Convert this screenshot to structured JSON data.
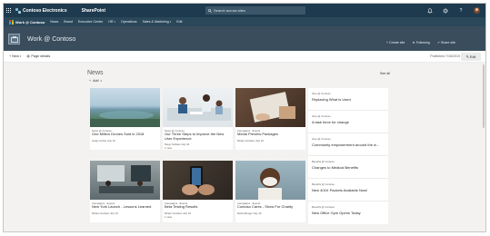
{
  "suite": {
    "brand": "Contoso Electronics",
    "app": "SharePoint",
    "search_placeholder": "Search across sites",
    "icons": [
      "app-launcher-icon",
      "notifications-icon",
      "settings-icon",
      "help-icon",
      "user-avatar"
    ]
  },
  "hub": {
    "title": "Work @ Contoso",
    "items": [
      {
        "label": "News",
        "caret": false
      },
      {
        "label": "Brand",
        "caret": false
      },
      {
        "label": "Executive Center",
        "caret": false
      },
      {
        "label": "HR",
        "caret": true
      },
      {
        "label": "Operations",
        "caret": false
      },
      {
        "label": "Sales & Marketing",
        "caret": true
      },
      {
        "label": "Edit",
        "caret": false
      }
    ]
  },
  "site": {
    "title": "Work @ Contoso",
    "actions": {
      "create": "+ Create site",
      "following": "Following",
      "share": "Share site"
    }
  },
  "commandbar": {
    "new": "New",
    "page_details": "Page details",
    "published": "Published 7/16/2019",
    "edit": "Edit"
  },
  "news": {
    "title": "News",
    "add": "Add",
    "see_all": "See all",
    "cards": [
      {
        "category": "News @ Contoso",
        "title": "One Million Drones Sold in 2018",
        "author": "Grady Archie",
        "date": "July 16",
        "views": ""
      },
      {
        "category": "News @ Contoso",
        "title": "Our Three Steps to Improve the New User Experience",
        "author": "Diego Siciliani",
        "date": "July 16",
        "views": "1 view"
      },
      {
        "category": "Campaigns · Events",
        "title": "Media Preview Packages",
        "author": "Miriam Graham",
        "date": "July 16",
        "views": ""
      },
      {
        "category": "Campaigns · Events",
        "title": "New York Launch - Lessons Learned",
        "author": "Miriam Graham",
        "date": "July 16",
        "views": ""
      },
      {
        "category": "Campaigns · Events",
        "title": "Beta Testing Results",
        "author": "Miriam Graham",
        "date": "July 16",
        "views": "1 view"
      },
      {
        "category": "Campaigns · Events",
        "title": "Contoso Cares - Show For Charity",
        "author": "Debra Berger",
        "date": "July 16",
        "views": ""
      }
    ],
    "side": [
      {
        "category": "Give @ Contoso",
        "title": "Replacing What is Used"
      },
      {
        "category": "Give @ Contoso",
        "title": "A task force for change"
      },
      {
        "category": "Give @ Contoso",
        "title": "Community empowerment around the w..."
      },
      {
        "category": "Benefits @ Contoso",
        "title": "Changes to Medical Benefits"
      },
      {
        "category": "Benefits @ Contoso",
        "title": "New 401K Packets Available Now!"
      },
      {
        "category": "Benefits @ Contoso",
        "title": "New Office Gym Opens Today"
      }
    ]
  }
}
